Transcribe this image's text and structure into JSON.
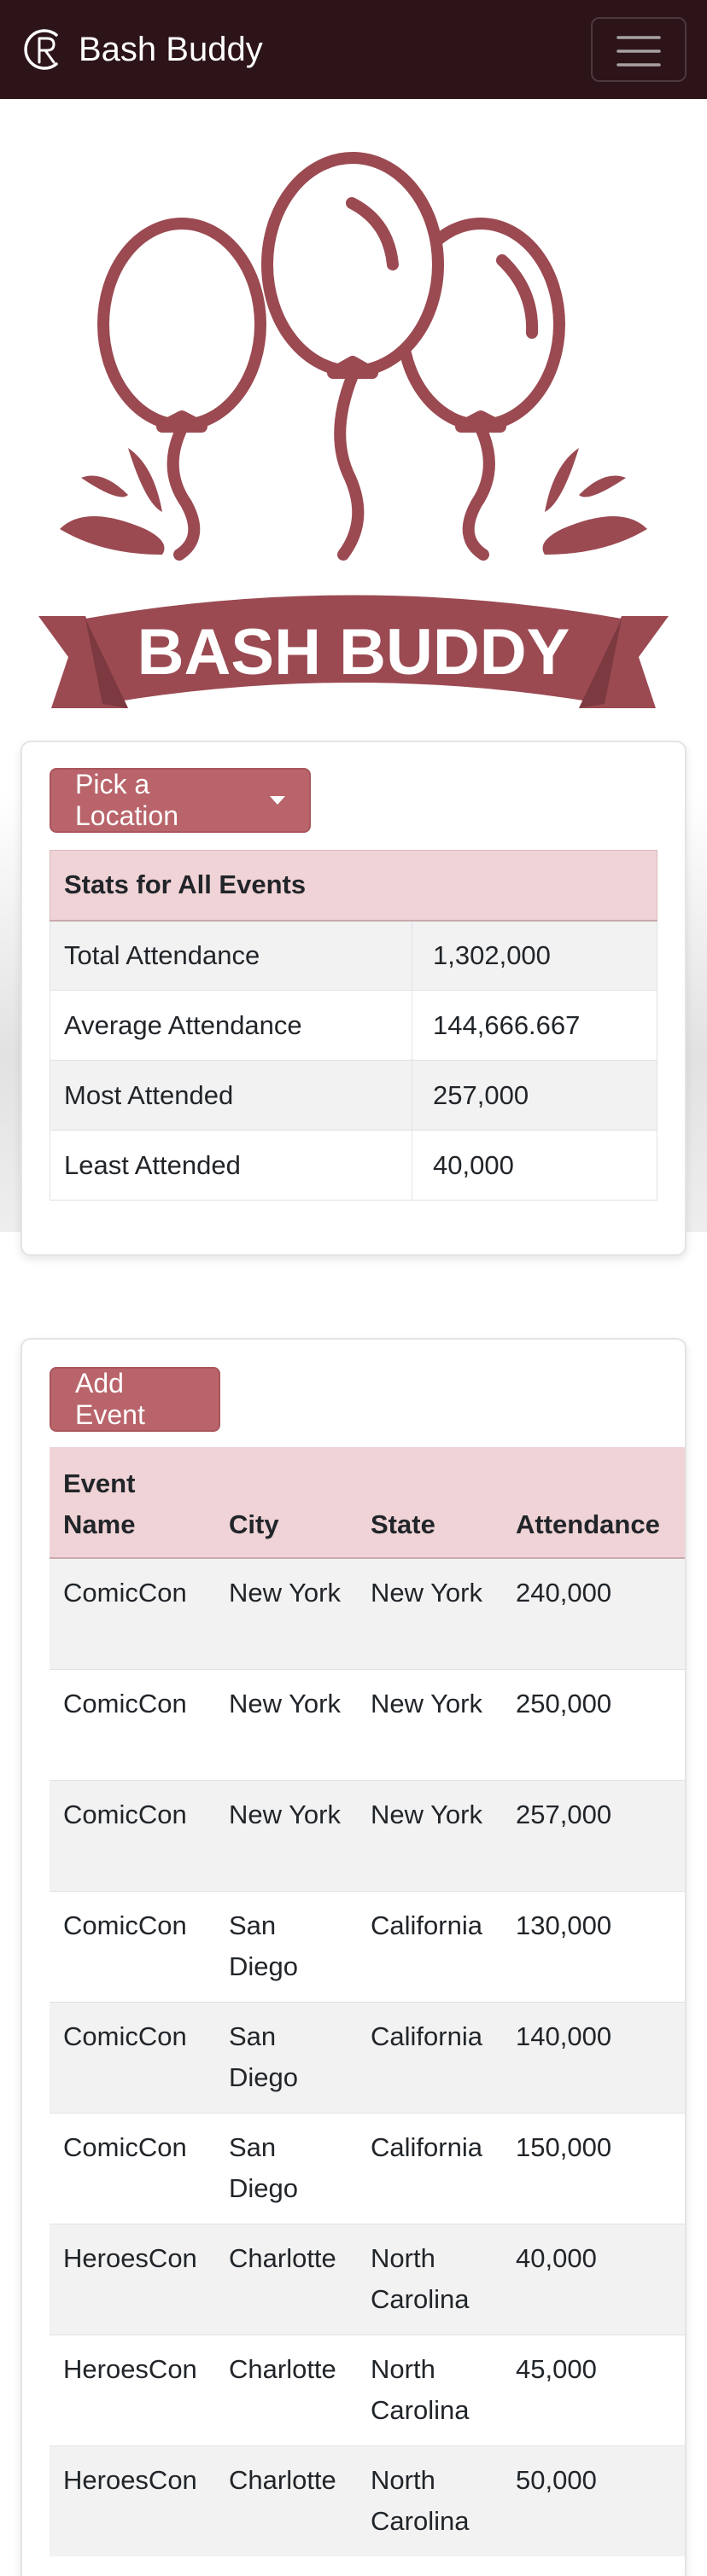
{
  "navbar": {
    "brand": "Bash Buddy",
    "logo_icon": "rb-monogram-icon",
    "menu_icon": "hamburger-menu-icon",
    "background": "#2c1419"
  },
  "hero": {
    "logo_text": "BASH BUDDY",
    "logo_icon": "balloons-banner-logo",
    "accent": "#9b4a52"
  },
  "stats": {
    "location_button": "Pick a Location",
    "header": "Stats for All Events",
    "rows": [
      {
        "label": "Total Attendance",
        "value": "1,302,000"
      },
      {
        "label": "Average Attendance",
        "value": "144,666.667"
      },
      {
        "label": "Most Attended",
        "value": "257,000"
      },
      {
        "label": "Least Attended",
        "value": "40,000"
      }
    ]
  },
  "events": {
    "add_button": "Add Event",
    "columns": [
      "Event Name",
      "City",
      "State",
      "Attendance"
    ],
    "rows": [
      {
        "name": "ComicCon",
        "city": "New York",
        "state": "New York",
        "attendance": "240,000"
      },
      {
        "name": "ComicCon",
        "city": "New York",
        "state": "New York",
        "attendance": "250,000"
      },
      {
        "name": "ComicCon",
        "city": "New York",
        "state": "New York",
        "attendance": "257,000"
      },
      {
        "name": "ComicCon",
        "city": "San Diego",
        "state": "California",
        "attendance": "130,000"
      },
      {
        "name": "ComicCon",
        "city": "San Diego",
        "state": "California",
        "attendance": "140,000"
      },
      {
        "name": "ComicCon",
        "city": "San Diego",
        "state": "California",
        "attendance": "150,000"
      },
      {
        "name": "HeroesCon",
        "city": "Charlotte",
        "state": "North Carolina",
        "attendance": "40,000"
      },
      {
        "name": "HeroesCon",
        "city": "Charlotte",
        "state": "North Carolina",
        "attendance": "45,000"
      },
      {
        "name": "HeroesCon",
        "city": "Charlotte",
        "state": "North Carolina",
        "attendance": "50,000"
      }
    ]
  },
  "colors": {
    "button": "#b9646a",
    "table_header": "#efd3d6"
  }
}
